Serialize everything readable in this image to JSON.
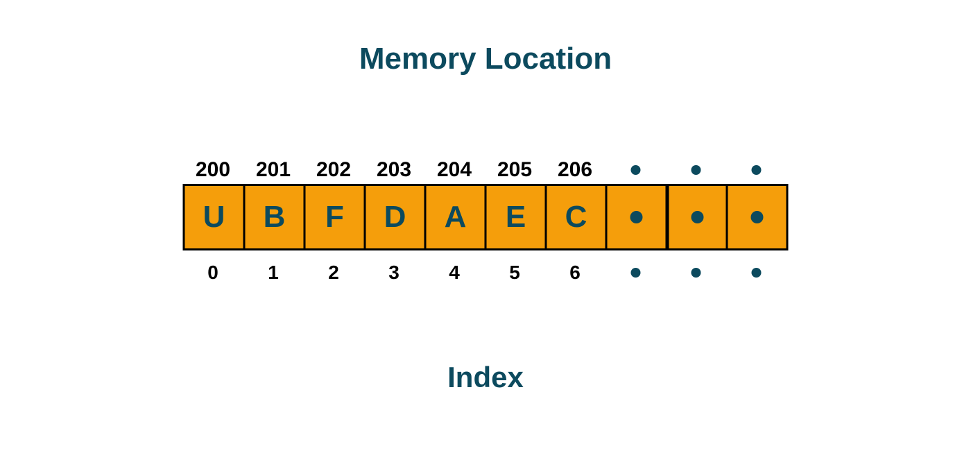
{
  "title_top": "Memory Location",
  "title_bottom": "Index",
  "colors": {
    "heading": "#0c4a5e",
    "cell_bg": "#f59e0b",
    "cell_text": "#0c4a5e",
    "border": "#000000",
    "label": "#000000"
  },
  "addresses": [
    "200",
    "201",
    "202",
    "203",
    "204",
    "205",
    "206",
    "•",
    "•",
    "•"
  ],
  "cells": [
    "U",
    "B",
    "F",
    "D",
    "A",
    "E",
    "C",
    "•",
    "•",
    "•"
  ],
  "indices": [
    "0",
    "1",
    "2",
    "3",
    "4",
    "5",
    "6",
    "•",
    "•",
    "•"
  ]
}
